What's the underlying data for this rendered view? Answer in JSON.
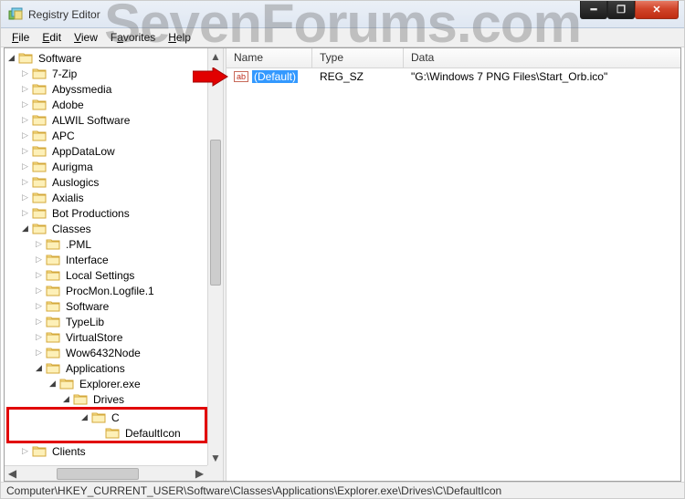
{
  "window": {
    "title": "Registry Editor"
  },
  "menu": {
    "file": "File",
    "edit": "Edit",
    "view": "View",
    "favorites": "Favorites",
    "help": "Help"
  },
  "tree": {
    "software": "Software",
    "items1": [
      "7-Zip",
      "Abyssmedia",
      "Adobe",
      "ALWIL Software",
      "APC",
      "AppDataLow",
      "Aurigma",
      "Auslogics",
      "Axialis",
      "Bot Productions"
    ],
    "classes": "Classes",
    "items2": [
      ".PML",
      "Interface",
      "Local Settings",
      "ProcMon.Logfile.1",
      "Software",
      "TypeLib",
      "VirtualStore",
      "Wow6432Node"
    ],
    "applications": "Applications",
    "explorer": "Explorer.exe",
    "drives": "Drives",
    "c": "C",
    "defaulticon": "DefaultIcon",
    "clients": "Clients"
  },
  "list": {
    "cols": {
      "name": "Name",
      "type": "Type",
      "data": "Data"
    },
    "rows": [
      {
        "icon": "ab",
        "name": "(Default)",
        "type": "REG_SZ",
        "data": "\"G:\\Windows 7 PNG Files\\Start_Orb.ico\""
      }
    ]
  },
  "status": "Computer\\HKEY_CURRENT_USER\\Software\\Classes\\Applications\\Explorer.exe\\Drives\\C\\DefaultIcon",
  "watermark": "SevenForums.com"
}
